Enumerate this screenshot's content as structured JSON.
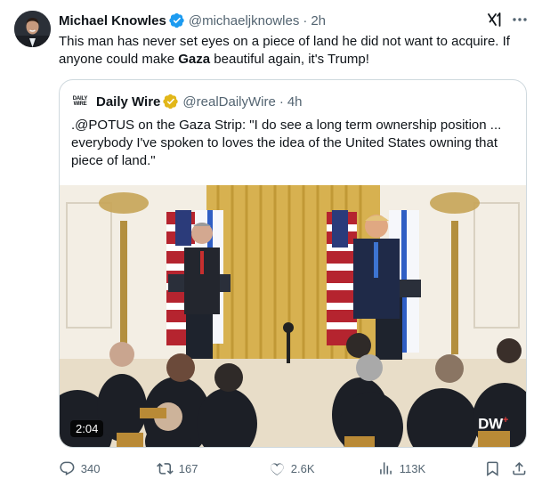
{
  "tweet": {
    "author_name": "Michael Knowles",
    "author_handle": "@michaeljknowles",
    "separator": "·",
    "timestamp": "2h",
    "text_before": "This man has never set eyes on a piece of land he did not want to acquire. If anyone could make ",
    "text_bold": "Gaza",
    "text_after": " beautiful again, it's Trump!"
  },
  "quote": {
    "logo_line1": "DAILY",
    "logo_line2": "WIRE",
    "author_name": "Daily Wire",
    "author_handle": "@realDailyWire",
    "separator": "·",
    "timestamp": "4h",
    "text": ".@POTUS on the Gaza Strip: \"I do see a long term ownership position ... everybody I've spoken to loves the idea of the United States owning that piece of land.\"",
    "video_duration": "2:04",
    "video_watermark": "DW",
    "video_watermark_plus": "+"
  },
  "actions": {
    "replies": "340",
    "reposts": "167",
    "likes": "2.6K",
    "views": "113K"
  },
  "colors": {
    "verified": "#1d9bf0",
    "gold_verified": "#e2b719",
    "secondary_text": "#536471",
    "border": "#cfd9de"
  },
  "icons": [
    "grok-icon",
    "more-icon",
    "verified-icon",
    "reply-icon",
    "retweet-icon",
    "like-icon",
    "views-icon",
    "bookmark-icon",
    "share-icon"
  ]
}
